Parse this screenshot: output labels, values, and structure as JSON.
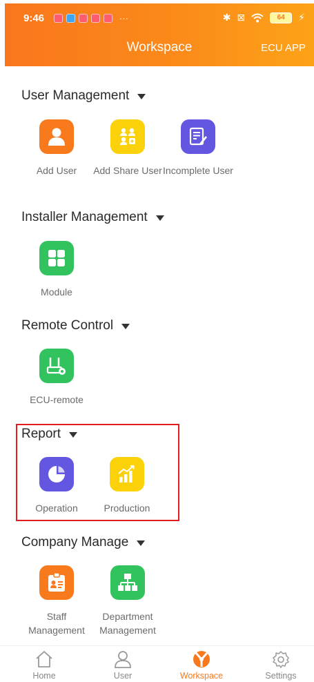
{
  "status_bar": {
    "time": "9:46",
    "more": "···",
    "battery": "64"
  },
  "header": {
    "title": "Workspace",
    "right_action": "ECU APP"
  },
  "sections": {
    "user_management": {
      "title": "User Management",
      "items": [
        {
          "label": "Add User",
          "icon": "person-icon",
          "color": "#f97a1d"
        },
        {
          "label": "Add Share User",
          "icon": "group-icon",
          "color": "#fbd20a"
        },
        {
          "label": "Incomplete User",
          "icon": "edit-document-icon",
          "color": "#6356e0"
        }
      ]
    },
    "installer_management": {
      "title": "Installer Management",
      "items": [
        {
          "label": "Module",
          "icon": "grid-icon",
          "color": "#33c35e"
        }
      ]
    },
    "remote_control": {
      "title": "Remote Control",
      "items": [
        {
          "label": "ECU-remote",
          "icon": "router-icon",
          "color": "#33c35e"
        }
      ]
    },
    "report": {
      "title": "Report",
      "items": [
        {
          "label": "Operation",
          "icon": "pie-chart-icon",
          "color": "#6356e0"
        },
        {
          "label": "Production",
          "icon": "bar-chart-icon",
          "color": "#fbd20a"
        }
      ]
    },
    "company_manage": {
      "title": "Company Manage",
      "items": [
        {
          "label": "Staff Management",
          "icon": "badge-icon",
          "color": "#f97a1d"
        },
        {
          "label": "Department Management",
          "icon": "org-chart-icon",
          "color": "#33c35e"
        }
      ]
    }
  },
  "bottom_nav": {
    "items": [
      {
        "label": "Home",
        "icon": "home-icon"
      },
      {
        "label": "User",
        "icon": "user-icon"
      },
      {
        "label": "Workspace",
        "icon": "workspace-icon",
        "active": true
      },
      {
        "label": "Settings",
        "icon": "gear-icon"
      }
    ]
  },
  "colors": {
    "accent": "#f97a1d",
    "highlight_border": "#e41b21"
  }
}
